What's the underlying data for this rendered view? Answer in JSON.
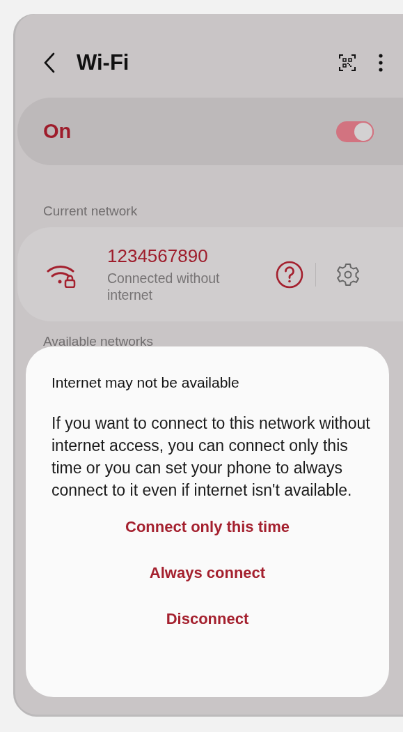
{
  "header": {
    "title": "Wi-Fi"
  },
  "wifi_switch": {
    "label": "On",
    "on": true
  },
  "current_network": {
    "heading": "Current network",
    "name": "1234567890",
    "status": "Connected without internet"
  },
  "available_networks": {
    "heading": "Available networks"
  },
  "dialog": {
    "title": "Internet may not be available",
    "message": "If you want to connect to this network without internet access, you can connect only this time or you can set your phone to always connect to it even if internet isn't available.",
    "actions": [
      "Connect only this time",
      "Always connect",
      "Disconnect"
    ]
  }
}
